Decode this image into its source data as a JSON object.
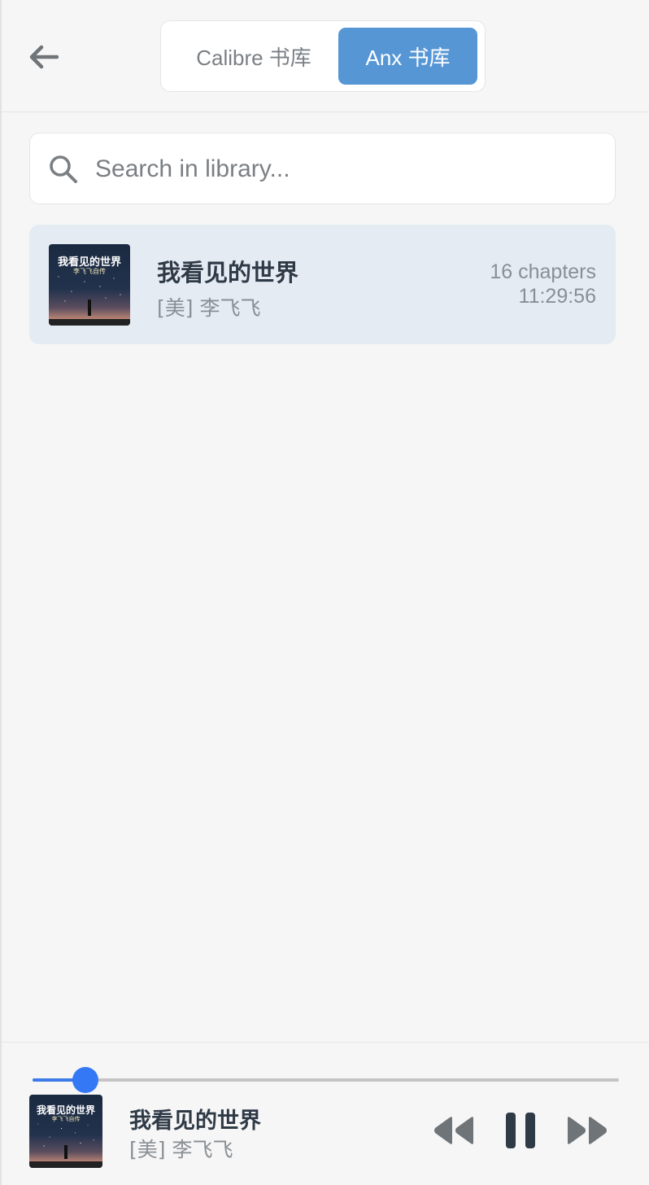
{
  "header": {
    "tabs": [
      {
        "label": "Calibre 书库",
        "active": false
      },
      {
        "label": "Anx 书库",
        "active": true
      }
    ]
  },
  "search": {
    "placeholder": "Search in library...",
    "value": ""
  },
  "books": [
    {
      "title": "我看见的世界",
      "author": "[美] 李飞飞",
      "chapters": "16 chapters",
      "duration": "11:29:56",
      "cover_text": {
        "title": "我看见的世界",
        "subtitle": "李飞飞自传"
      }
    }
  ],
  "player": {
    "title": "我看见的世界",
    "author": "[美] 李飞飞",
    "progress_percent": 9,
    "cover_text": {
      "title": "我看见的世界",
      "subtitle": "李飞飞自传"
    }
  },
  "colors": {
    "accent": "#5696d5",
    "progress": "#3478f6",
    "card_bg": "#e5ebf3",
    "background": "#f6f6f6"
  },
  "icons": [
    "back-arrow-icon",
    "search-icon",
    "rewind-icon",
    "pause-icon",
    "fast-forward-icon"
  ]
}
